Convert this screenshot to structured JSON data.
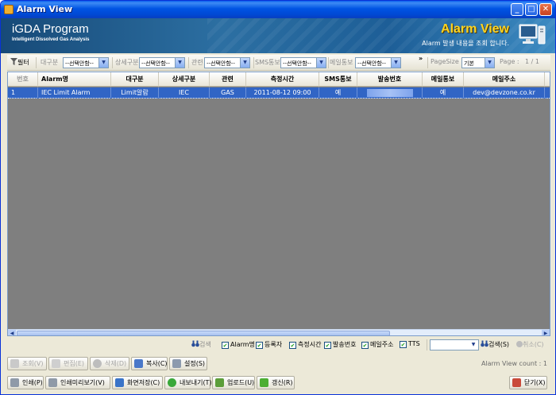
{
  "window": {
    "title": "Alarm View",
    "buttons": {
      "minimize": "_",
      "maximize": "□",
      "close": "✕"
    }
  },
  "banner": {
    "program_title": "iGDA Program",
    "program_subtitle": "Intelligent Dissolved Gas Analysis",
    "view_title": "Alarm View",
    "view_subtitle": "Alarm 발생 내용을 조회 합니다."
  },
  "filter": {
    "filter_label": "필터",
    "major_label": "대구분",
    "major_value": "--선택안함--",
    "detail_label": "상세구분",
    "detail_value": "--선택안함--",
    "relation_label": "관련",
    "relation_value": "--선택안함--",
    "sms_label": "SMS통보",
    "sms_value": "--선택안함--",
    "mail_label": "메일통보",
    "mail_value": "--선택안함--",
    "overflow": "»",
    "pagesize_label": "PageSize",
    "pagesize_value": "기본",
    "page_label": "Page :",
    "page_value": "1 / 1"
  },
  "grid": {
    "columns": [
      "번호",
      "Alarm명",
      "대구분",
      "상세구분",
      "관련",
      "측정시간",
      "SMS통보",
      "발송번호",
      "메일통보",
      "메일주소"
    ],
    "rows": [
      {
        "no": "1",
        "name": "IEC Limit Alarm",
        "major": "Limit알람",
        "detail": "IEC",
        "relation": "GAS",
        "time": "2011-08-12 09:00",
        "sms": "예",
        "phone": "",
        "mail": "예",
        "email": "dev@devzone.co.kr"
      }
    ]
  },
  "search": {
    "search_label": "검색",
    "checks": [
      "Alarm명",
      "등록자",
      "측정시간",
      "발송번호",
      "메일주소",
      "TTS"
    ],
    "search_button": "검색(S)",
    "cancel_button": "취소(C)"
  },
  "toolbar1": {
    "view": "조회(V)",
    "edit": "편집(E)",
    "delete": "삭제(D)",
    "copy": "복사(C)",
    "settings": "설정(S)",
    "count_text": "Alarm View count : 1"
  },
  "toolbar2": {
    "print": "인쇄(P)",
    "preview": "인쇄미리보기(V)",
    "save_screen": "화면저장(C)",
    "export": "내보내기(T)",
    "upload": "업로드(U)",
    "refresh": "갱신(R)",
    "close": "닫기(X)"
  },
  "colors": {
    "titlebar": "#0054e3",
    "selection": "#3165c5",
    "grid_bg": "#7f7f7f",
    "accent": "#ffd420"
  }
}
